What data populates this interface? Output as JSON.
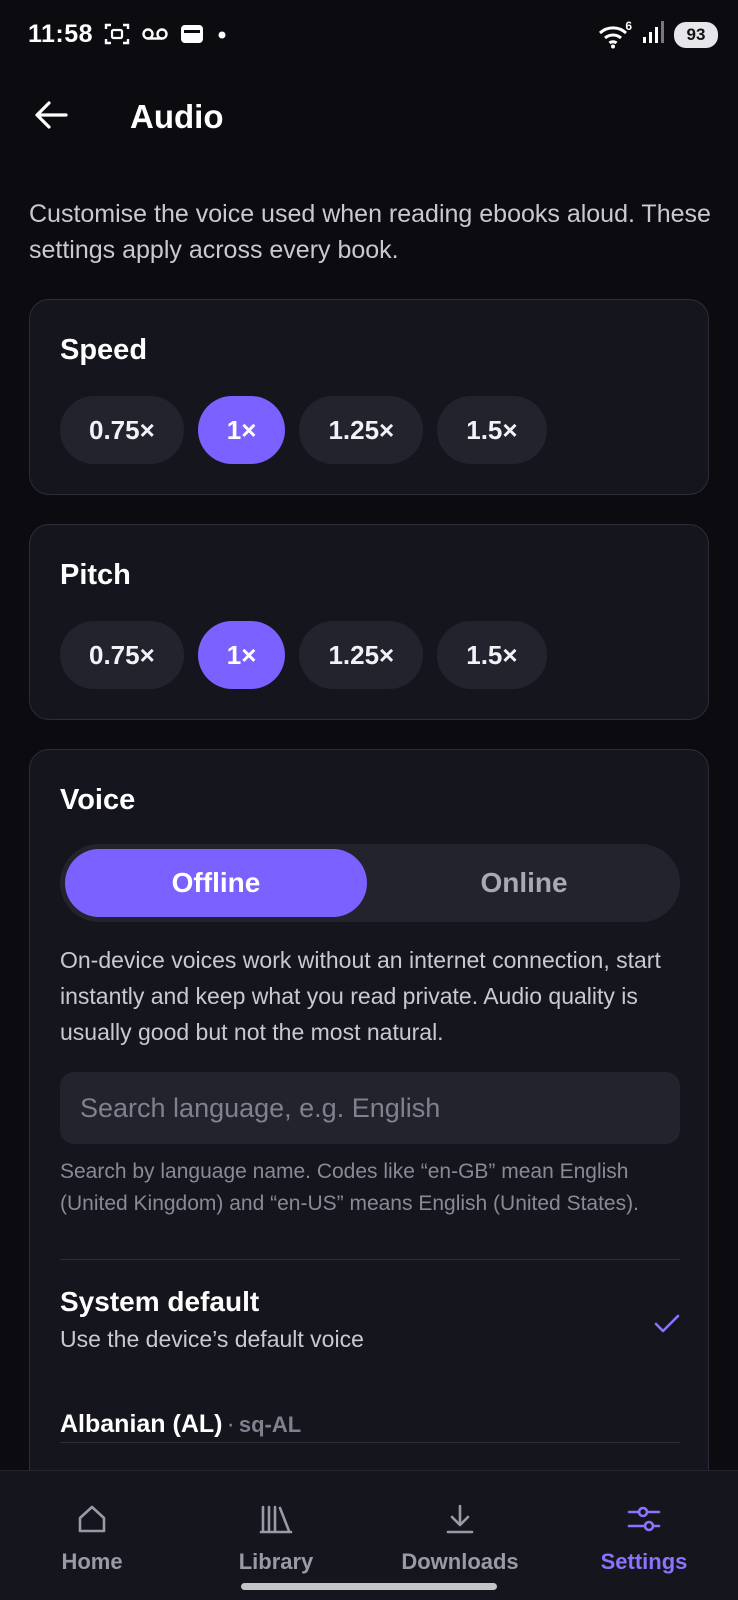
{
  "status_bar": {
    "time": "11:58",
    "battery": "93",
    "icons_left": [
      "screenshot-icon",
      "voicemail-icon",
      "sim-card-icon",
      "dot-icon"
    ],
    "icons_right": [
      "wifi-icon",
      "signal-icon",
      "battery-icon"
    ],
    "wifi_label": "6"
  },
  "header": {
    "title": "Audio",
    "back_icon": "arrow-left-icon"
  },
  "intro": "Customise the voice used when reading ebooks aloud. These settings apply across every book.",
  "speed": {
    "title": "Speed",
    "options": [
      "0.75×",
      "1×",
      "1.25×",
      "1.5×"
    ],
    "selected": "1×"
  },
  "pitch": {
    "title": "Pitch",
    "options": [
      "0.75×",
      "1×",
      "1.25×",
      "1.5×"
    ],
    "selected": "1×"
  },
  "voice": {
    "title": "Voice",
    "tabs": {
      "offline": "Offline",
      "online": "Online"
    },
    "selected_tab": "Offline",
    "description": "On-device voices work without an internet connection, start instantly and keep what you read private. Audio quality is usually good but not the most natural.",
    "search": {
      "placeholder": "Search language, e.g. English",
      "value": ""
    },
    "search_help": "Search by language name. Codes like “en-GB” mean English (United Kingdom) and “en-US” means English (United States).",
    "system_default": {
      "title": "System default",
      "subtitle": "Use the device’s default voice",
      "selected": true
    },
    "languages": [
      {
        "name": "Albanian (AL)",
        "separator": "·",
        "code": "sq-AL"
      }
    ]
  },
  "bottom_nav": {
    "items": [
      {
        "label": "Home",
        "icon": "home-icon"
      },
      {
        "label": "Library",
        "icon": "library-icon"
      },
      {
        "label": "Downloads",
        "icon": "download-icon"
      },
      {
        "label": "Settings",
        "icon": "settings-sliders-icon"
      }
    ],
    "active": "Settings"
  },
  "colors": {
    "accent": "#7b61ff",
    "background": "#0b0b10",
    "card": "#15151d",
    "chip": "#23232e"
  }
}
